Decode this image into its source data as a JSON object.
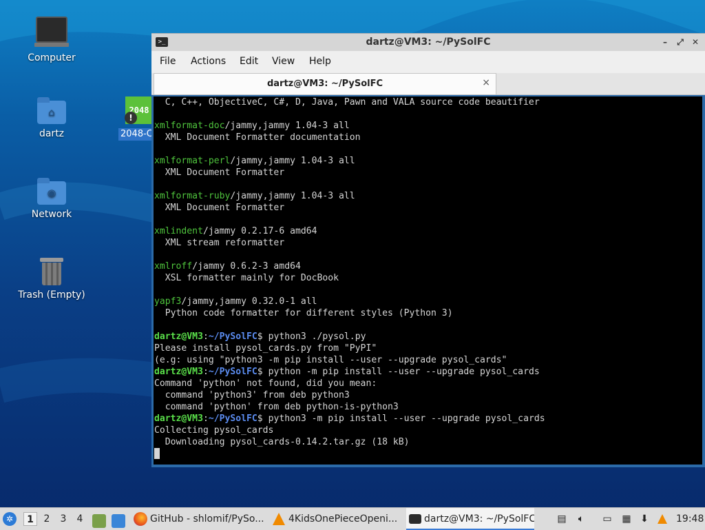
{
  "desktop": {
    "icons": [
      {
        "label": "Computer"
      },
      {
        "label": "dartz"
      },
      {
        "label": "Network"
      },
      {
        "label": "Trash (Empty)"
      }
    ],
    "game_icon": {
      "tile": "2048",
      "label": "2048-C"
    }
  },
  "window": {
    "title": "dartz@VM3: ~/PySolFC",
    "menu": [
      "File",
      "Actions",
      "Edit",
      "View",
      "Help"
    ],
    "tab_title": "dartz@VM3: ~/PySolFC",
    "close_glyph": "×"
  },
  "terminal": {
    "lines": [
      {
        "type": "plain",
        "text": "  C, C++, ObjectiveC, C#, D, Java, Pawn and VALA source code beautifier"
      },
      {
        "type": "blank"
      },
      {
        "type": "pkg",
        "name": "xmlformat-doc",
        "rest": "/jammy,jammy 1.04-3 all"
      },
      {
        "type": "plain",
        "text": "  XML Document Formatter documentation"
      },
      {
        "type": "blank"
      },
      {
        "type": "pkg",
        "name": "xmlformat-perl",
        "rest": "/jammy,jammy 1.04-3 all"
      },
      {
        "type": "plain",
        "text": "  XML Document Formatter"
      },
      {
        "type": "blank"
      },
      {
        "type": "pkg",
        "name": "xmlformat-ruby",
        "rest": "/jammy,jammy 1.04-3 all"
      },
      {
        "type": "plain",
        "text": "  XML Document Formatter"
      },
      {
        "type": "blank"
      },
      {
        "type": "pkg",
        "name": "xmlindent",
        "rest": "/jammy 0.2.17-6 amd64"
      },
      {
        "type": "plain",
        "text": "  XML stream reformatter"
      },
      {
        "type": "blank"
      },
      {
        "type": "pkg",
        "name": "xmlroff",
        "rest": "/jammy 0.6.2-3 amd64"
      },
      {
        "type": "plain",
        "text": "  XSL formatter mainly for DocBook"
      },
      {
        "type": "blank"
      },
      {
        "type": "pkg",
        "name": "yapf3",
        "rest": "/jammy,jammy 0.32.0-1 all"
      },
      {
        "type": "plain",
        "text": "  Python code formatter for different styles (Python 3)"
      },
      {
        "type": "blank"
      },
      {
        "type": "prompt",
        "user": "dartz@VM3",
        "path": "~/PySolFC",
        "cmd": "$ python3 ./pysol.py"
      },
      {
        "type": "plain",
        "text": "Please install pysol_cards.py from \"PyPI\""
      },
      {
        "type": "plain",
        "text": "(e.g: using \"python3 -m pip install --user --upgrade pysol_cards\""
      },
      {
        "type": "prompt",
        "user": "dartz@VM3",
        "path": "~/PySolFC",
        "cmd": "$ python -m pip install --user --upgrade pysol_cards"
      },
      {
        "type": "plain",
        "text": "Command 'python' not found, did you mean:"
      },
      {
        "type": "plain",
        "text": "  command 'python3' from deb python3"
      },
      {
        "type": "plain",
        "text": "  command 'python' from deb python-is-python3"
      },
      {
        "type": "prompt",
        "user": "dartz@VM3",
        "path": "~/PySolFC",
        "cmd": "$ python3 -m pip install --user --upgrade pysol_cards"
      },
      {
        "type": "plain",
        "text": "Collecting pysol_cards"
      },
      {
        "type": "plain",
        "text": "  Downloading pysol_cards-0.14.2.tar.gz (18 kB)"
      },
      {
        "type": "cursor"
      }
    ],
    "colors": {
      "background": "#000000",
      "text": "#d6d6d6",
      "package": "#4fc43d",
      "prompt_user": "#5ae04a",
      "prompt_path": "#5b8cf0"
    }
  },
  "taskbar": {
    "workspaces": [
      "1",
      "2",
      "3",
      "4"
    ],
    "active_workspace": "1",
    "tasks": [
      {
        "label": "GitHub - shlomif/PySo...",
        "icon": "firefox-icon"
      },
      {
        "label": "4KidsOnePieceOpeni...",
        "icon": "vlc-icon"
      },
      {
        "label": "dartz@VM3: ~/PySolFC",
        "icon": "terminal-icon"
      }
    ],
    "clock": "19:48"
  }
}
